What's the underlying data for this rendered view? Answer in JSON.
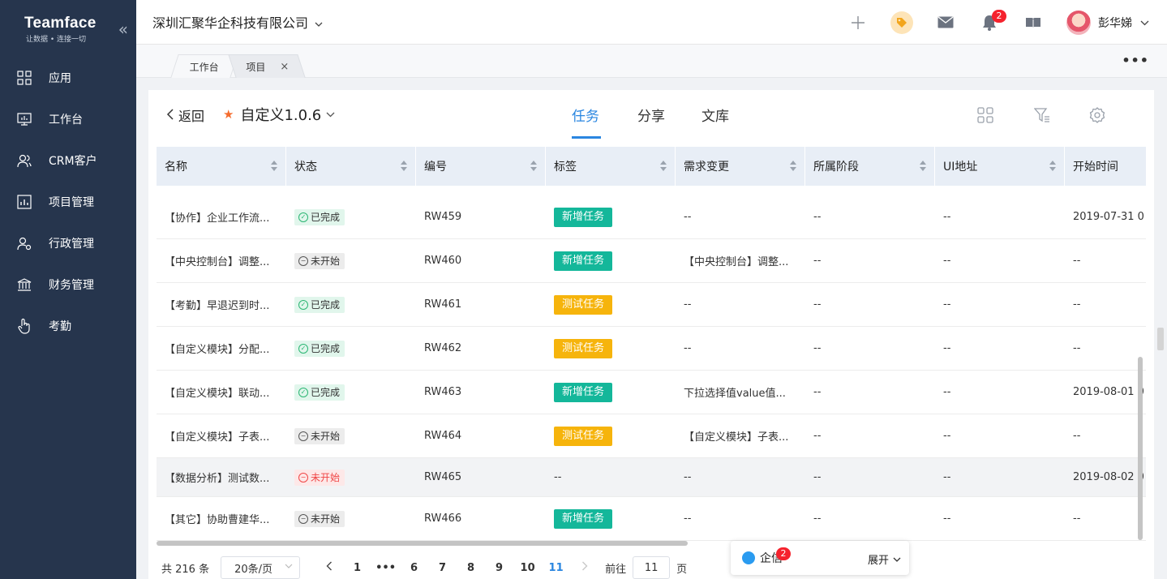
{
  "brand": {
    "name": "Teamface",
    "slogan": "让数据 • 连接一切"
  },
  "sidebar": {
    "items": [
      {
        "label": "应用",
        "icon": "apps-icon"
      },
      {
        "label": "工作台",
        "icon": "monitor-icon"
      },
      {
        "label": "CRM客户",
        "icon": "customers-icon"
      },
      {
        "label": "项目管理",
        "icon": "project-icon"
      },
      {
        "label": "行政管理",
        "icon": "admin-icon"
      },
      {
        "label": "财务管理",
        "icon": "finance-icon"
      },
      {
        "label": "考勤",
        "icon": "hand-pointer-icon"
      }
    ]
  },
  "header": {
    "company": "深圳汇聚华企科技有限公司",
    "notification_count": "2",
    "user_name": "彭华娣"
  },
  "tabs": {
    "workbench": "工作台",
    "project": "项目"
  },
  "project": {
    "back_label": "返回",
    "title": "自定义1.0.6",
    "tabs": [
      "任务",
      "分享",
      "文库"
    ]
  },
  "table": {
    "columns": [
      "名称",
      "状态",
      "编号",
      "标签",
      "需求变更",
      "所属阶段",
      "UI地址",
      "开始时间"
    ],
    "rows": [
      {
        "name": "【协作】企业工作流...",
        "status": "已完成",
        "status_type": "done",
        "code": "RW459",
        "tag": "新增任务",
        "tag_color": "#14b79a",
        "change": "--",
        "stage": "--",
        "ui": "--",
        "start": "2019-07-31 0"
      },
      {
        "name": "【中央控制台】调整...",
        "status": "未开始",
        "status_type": "todo",
        "code": "RW460",
        "tag": "新增任务",
        "tag_color": "#14b79a",
        "change": "【中央控制台】调整...",
        "stage": "--",
        "ui": "--",
        "start": "--"
      },
      {
        "name": "【考勤】早退迟到时...",
        "status": "已完成",
        "status_type": "done",
        "code": "RW461",
        "tag": "测试任务",
        "tag_color": "#f6b40c",
        "change": "--",
        "stage": "--",
        "ui": "--",
        "start": "--"
      },
      {
        "name": "【自定义模块】分配...",
        "status": "已完成",
        "status_type": "done",
        "code": "RW462",
        "tag": "测试任务",
        "tag_color": "#f6b40c",
        "change": "--",
        "stage": "--",
        "ui": "--",
        "start": "--"
      },
      {
        "name": "【自定义模块】联动...",
        "status": "已完成",
        "status_type": "done",
        "code": "RW463",
        "tag": "新增任务",
        "tag_color": "#14b79a",
        "change": "下拉选择值value值...",
        "stage": "--",
        "ui": "--",
        "start": "2019-08-01 0"
      },
      {
        "name": "【自定义模块】子表...",
        "status": "未开始",
        "status_type": "todo",
        "code": "RW464",
        "tag": "测试任务",
        "tag_color": "#f6b40c",
        "change": "【自定义模块】子表...",
        "stage": "--",
        "ui": "--",
        "start": "--"
      },
      {
        "name": "【数据分析】测试数...",
        "status": "未开始",
        "status_type": "overdue",
        "code": "RW465",
        "tag": "",
        "tag_text": "--",
        "change": "--",
        "stage": "--",
        "ui": "--",
        "start": "2019-08-02 0"
      },
      {
        "name": "【其它】协助曹建华...",
        "status": "未开始",
        "status_type": "todo",
        "code": "RW466",
        "tag": "新增任务",
        "tag_color": "#14b79a",
        "change": "--",
        "stage": "--",
        "ui": "--",
        "start": "--"
      }
    ]
  },
  "pagination": {
    "total": "共 216 条",
    "page_size": "20条/页",
    "pages": [
      "1",
      "•••",
      "6",
      "7",
      "8",
      "9",
      "10",
      "11"
    ],
    "current": "11",
    "goto_label": "前往",
    "goto_value": "11",
    "page_unit": "页"
  },
  "chat": {
    "label": "企信",
    "badge": "2",
    "expand": "展开"
  }
}
